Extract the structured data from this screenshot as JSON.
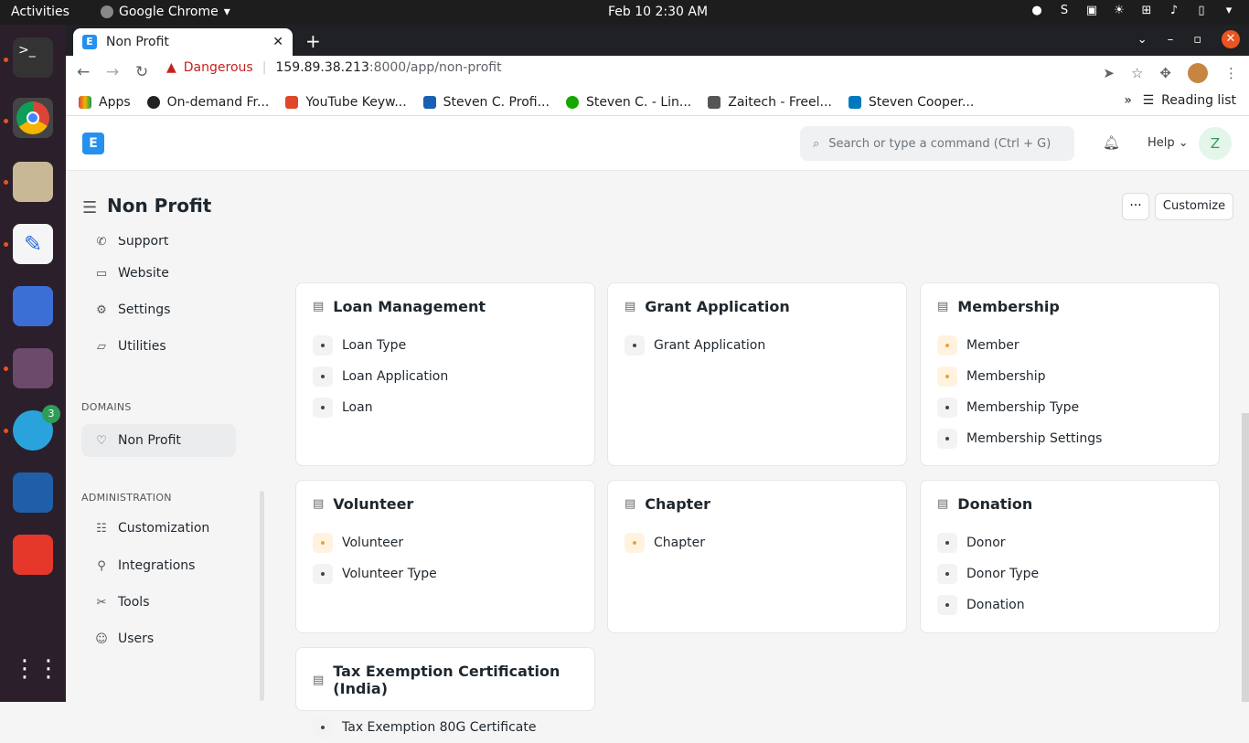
{
  "topbar": {
    "activities": "Activities",
    "app": "Google Chrome",
    "clock": "Feb 10  2:30 AM"
  },
  "dock": {
    "telegram_badge": "3"
  },
  "browser": {
    "tab_title": "Non Profit",
    "url_warning": "Dangerous",
    "url_host": "159.89.38.213",
    "url_path": ":8000/app/non-profit"
  },
  "bookmarks": [
    "Apps",
    "On-demand Fr...",
    "YouTube Keyw...",
    "Steven C. Profi...",
    "Steven C. - Lin...",
    "Zaitech - Freel...",
    "Steven Cooper..."
  ],
  "bookmarks_more": "»",
  "reading_list": "Reading list",
  "navbar": {
    "search_placeholder": "Search or type a command (Ctrl + G)",
    "help": "Help",
    "avatar": "Z",
    "logo": "E"
  },
  "page": {
    "title": "Non Profit",
    "more": "···",
    "customize": "Customize"
  },
  "sidebar": {
    "partial": "Support",
    "items_top": [
      {
        "label": "Website",
        "icon": "website-icon"
      },
      {
        "label": "Settings",
        "icon": "settings-icon"
      },
      {
        "label": "Utilities",
        "icon": "folder-icon"
      }
    ],
    "domains_title": "DOMAINS",
    "domain_item": "Non Profit",
    "admin_title": "ADMINISTRATION",
    "admin_items": [
      {
        "label": "Customization"
      },
      {
        "label": "Integrations"
      },
      {
        "label": "Tools"
      },
      {
        "label": "Users"
      }
    ]
  },
  "cards": [
    {
      "title": "Loan Management",
      "links": [
        {
          "label": "Loan Type",
          "accent": false
        },
        {
          "label": "Loan Application",
          "accent": false
        },
        {
          "label": "Loan",
          "accent": false
        }
      ]
    },
    {
      "title": "Grant Application",
      "links": [
        {
          "label": "Grant Application",
          "accent": false
        }
      ]
    },
    {
      "title": "Membership",
      "links": [
        {
          "label": "Member",
          "accent": true
        },
        {
          "label": "Membership",
          "accent": true
        },
        {
          "label": "Membership Type",
          "accent": false
        },
        {
          "label": "Membership Settings",
          "accent": false
        }
      ]
    },
    {
      "title": "Volunteer",
      "links": [
        {
          "label": "Volunteer",
          "accent": true
        },
        {
          "label": "Volunteer Type",
          "accent": false
        }
      ]
    },
    {
      "title": "Chapter",
      "links": [
        {
          "label": "Chapter",
          "accent": true
        }
      ]
    },
    {
      "title": "Donation",
      "links": [
        {
          "label": "Donor",
          "accent": false
        },
        {
          "label": "Donor Type",
          "accent": false
        },
        {
          "label": "Donation",
          "accent": false
        }
      ]
    },
    {
      "title": "Tax Exemption Certification (India)",
      "links": [
        {
          "label": "Tax Exemption 80G Certificate",
          "accent": false
        }
      ]
    }
  ]
}
